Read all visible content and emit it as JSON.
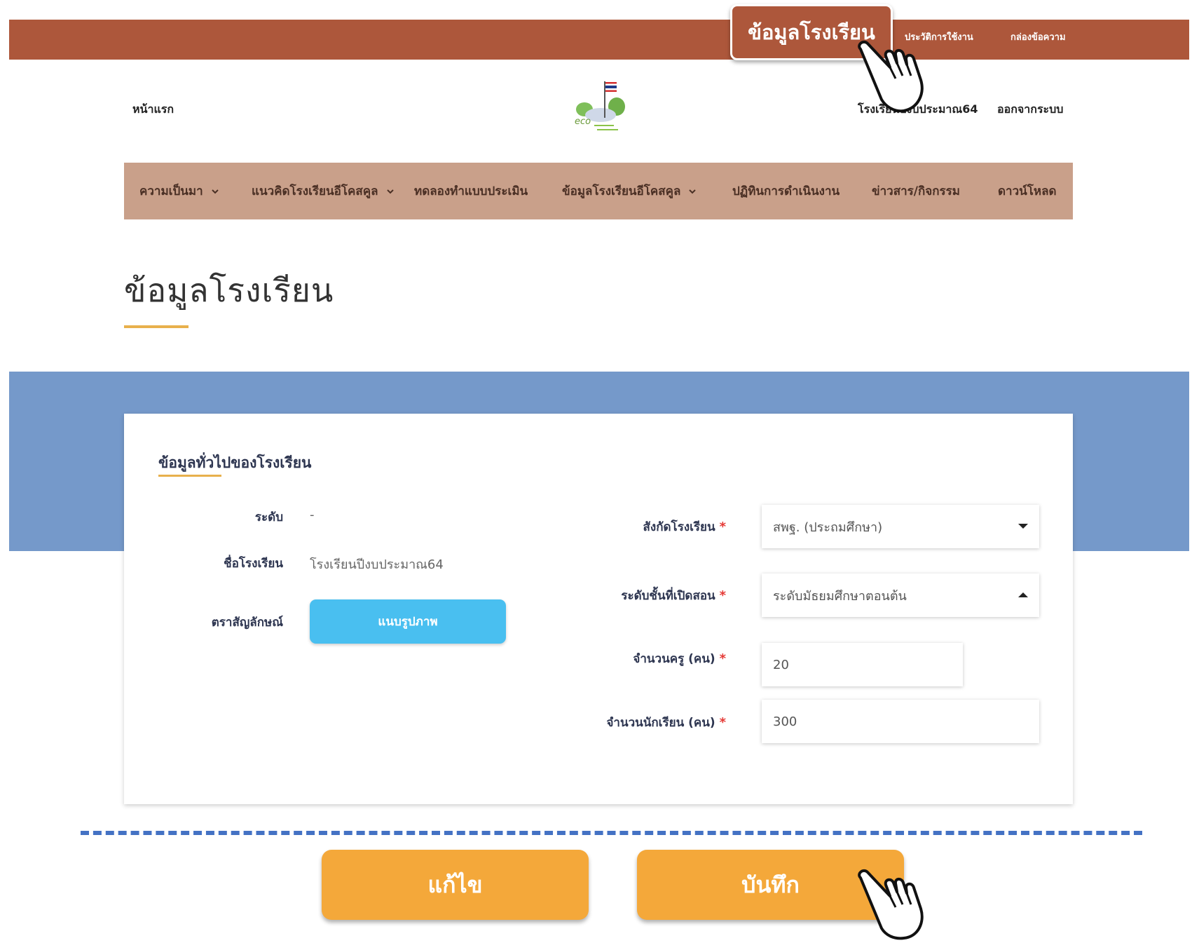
{
  "topbar": {
    "callout_label": "ข้อมูลโรงเรียน",
    "history_label": "ประวัติการใช้งาน",
    "inbox_label": "กล่องข้อความ"
  },
  "header": {
    "home_label": "หน้าแรก",
    "school_name": "โรงเรียนปีงบประมาณ64",
    "logout_label": "ออกจากระบบ",
    "logo_text": "eco"
  },
  "nav": {
    "items": [
      {
        "label": "ความเป็นมา",
        "has_dropdown": true
      },
      {
        "label": "แนวคิดโรงเรียนอีโคสคูล",
        "has_dropdown": true
      },
      {
        "label": "ทดลองทำแบบประเมิน",
        "has_dropdown": false
      },
      {
        "label": "ข้อมูลโรงเรียนอีโคสคูล",
        "has_dropdown": true
      },
      {
        "label": "ปฏิทินการดำเนินงาน",
        "has_dropdown": false
      },
      {
        "label": "ข่าวสาร/กิจกรรม",
        "has_dropdown": false
      },
      {
        "label": "ดาวน์โหลด",
        "has_dropdown": false
      }
    ]
  },
  "page": {
    "title": "ข้อมูลโรงเรียน"
  },
  "form": {
    "section_title": "ข้อมูลทั่วไปของโรงเรียน",
    "level_label": "ระดับ",
    "level_value": "-",
    "school_name_label": "ชื่อโรงเรียน",
    "school_name_value": "โรงเรียนปีงบประมาณ64",
    "logo_label": "ตราสัญลักษณ์",
    "logo_button": "แนบรูปภาพ",
    "affiliation_label": "สังกัดโรงเรียน",
    "affiliation_value": "สพฐ. (ประถมศึกษา)",
    "grade_label": "ระดับชั้นที่เปิดสอน",
    "grade_value": "ระดับมัธยมศึกษาตอนต้น",
    "teachers_label": "จำนวนครู (คน)",
    "teachers_value": "20",
    "students_label": "จำนวนนักเรียน (คน)",
    "students_value": "300",
    "required_mark": "*"
  },
  "actions": {
    "edit_label": "แก้ไข",
    "save_label": "บันทึก"
  },
  "colors": {
    "topbar": "#ad573b",
    "nav": "#c9a08a",
    "band": "#7599ca",
    "accent": "#e8b04c",
    "upload_button": "#49bff0",
    "action_button": "#f4a83a",
    "dash": "#4472c4"
  }
}
